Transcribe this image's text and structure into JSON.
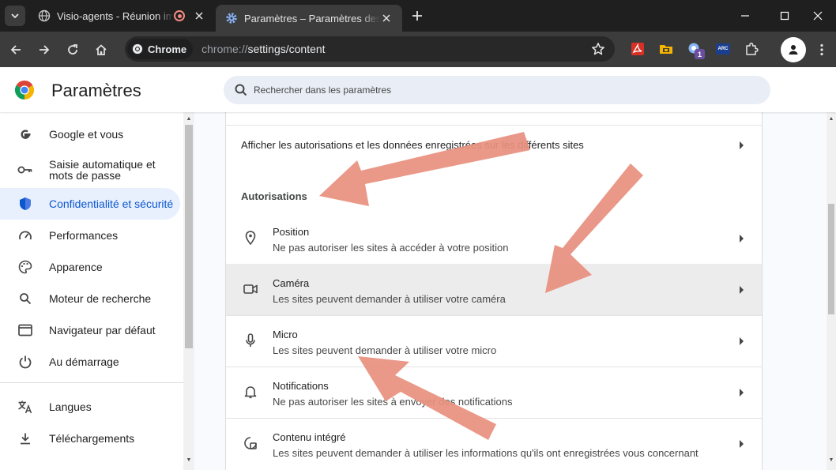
{
  "browser": {
    "tabs": [
      {
        "title": "Visio-agents - Réunion importante",
        "active": false,
        "recording": true
      },
      {
        "title": "Paramètres – Paramètres des sites",
        "active": true,
        "recording": false
      }
    ],
    "chip_label": "Chrome",
    "url_scheme": "chrome://",
    "url_path": "settings/content",
    "extension_badge": "1",
    "extension_arc_label": "ARC"
  },
  "header": {
    "title": "Paramètres",
    "search_placeholder": "Rechercher dans les paramètres"
  },
  "sidebar": {
    "items": [
      {
        "label": "Google et vous",
        "icon": "google-g-icon"
      },
      {
        "label": "Saisie automatique et mots de passe",
        "icon": "key-icon"
      },
      {
        "label": "Confidentialité et sécurité",
        "icon": "shield-icon",
        "active": true
      },
      {
        "label": "Performances",
        "icon": "speedometer-icon"
      },
      {
        "label": "Apparence",
        "icon": "palette-icon"
      },
      {
        "label": "Moteur de recherche",
        "icon": "search-icon"
      },
      {
        "label": "Navigateur par défaut",
        "icon": "browser-window-icon"
      },
      {
        "label": "Au démarrage",
        "icon": "power-icon"
      },
      {
        "label": "Langues",
        "icon": "translate-icon"
      },
      {
        "label": "Téléchargements",
        "icon": "download-icon"
      }
    ]
  },
  "content": {
    "view_data_row": "Afficher les autorisations et les données enregistrées sur les différents sites",
    "section_heading": "Autorisations",
    "permissions": [
      {
        "title": "Position",
        "subtitle": "Ne pas autoriser les sites à accéder à votre position",
        "icon": "location-pin-icon"
      },
      {
        "title": "Caméra",
        "subtitle": "Les sites peuvent demander à utiliser votre caméra",
        "icon": "camera-icon",
        "highlighted": true
      },
      {
        "title": "Micro",
        "subtitle": "Les sites peuvent demander à utiliser votre micro",
        "icon": "microphone-icon"
      },
      {
        "title": "Notifications",
        "subtitle": "Ne pas autoriser les sites à envoyer des notifications",
        "icon": "bell-icon"
      },
      {
        "title": "Contenu intégré",
        "subtitle": "Les sites peuvent demander à utiliser les informations qu'ils ont enregistrées vous concernant",
        "icon": "embedded-content-icon"
      }
    ]
  },
  "colors": {
    "accent": "#0b57d0",
    "active_nav_bg": "#e8f0fe",
    "arrow": "#e8907f",
    "dark_toolbar": "#3c3c3c",
    "highlight_row": "#ececec"
  }
}
